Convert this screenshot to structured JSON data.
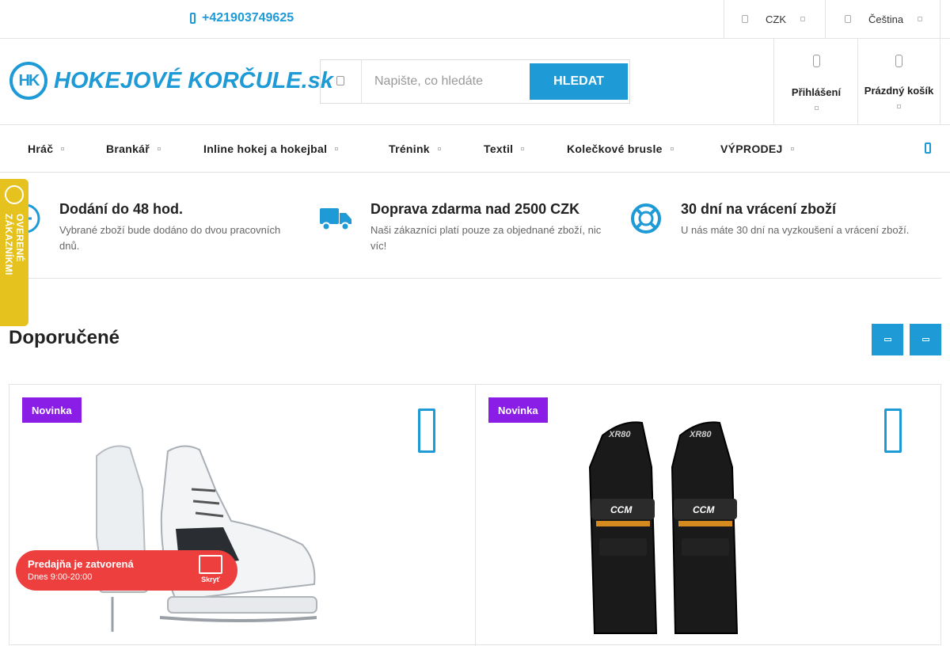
{
  "topbar": {
    "phone": "+421903749625",
    "currency": "CZK",
    "language": "Čeština"
  },
  "header": {
    "logo_text": "HOKEJOVÉ KORČULE.sk",
    "logo_mark": "HK",
    "search": {
      "placeholder": "Napište, co hledáte",
      "button_label": "HLEDAT"
    },
    "login_label": "Přihlášení",
    "cart_label": "Prázdný košík"
  },
  "nav": {
    "items": [
      {
        "label": "Hráč"
      },
      {
        "label": "Brankář"
      },
      {
        "label": "Inline hokej a hokejbal"
      },
      {
        "label": "Trénink"
      },
      {
        "label": "Textil"
      },
      {
        "label": "Kolečkové brusle"
      },
      {
        "label": "VÝPRODEJ"
      }
    ]
  },
  "benefits": [
    {
      "title": "Dodání do 48 hod.",
      "text": "Vybrané zboží bude dodáno do dvou pracovních dnů.",
      "icon": "clock-icon"
    },
    {
      "title": "Doprava zdarma nad 2500 CZK",
      "text": "Naši zákazníci platí pouze za objednané zboží, nic víc!",
      "icon": "truck-icon"
    },
    {
      "title": "30 dní na vrácení zboží",
      "text": "U nás máte 30 dní na vyzkoušení a vrácení zboží.",
      "icon": "lifebuoy-icon"
    }
  ],
  "section": {
    "title": "Doporučené"
  },
  "products": [
    {
      "badge": "Novinka",
      "image": "ice-skate"
    },
    {
      "badge": "Novinka",
      "image": "shin-guards",
      "brand_mark": "CCM",
      "model_mark": "XR80"
    }
  ],
  "side_badge": {
    "text": "OVERENÉ ZÁKAZNÍKMI"
  },
  "store_notice": {
    "title": "Predajňa je zatvorená",
    "hours": "Dnes 9:00-20:00",
    "hide_label": "Skryť"
  },
  "colors": {
    "accent": "#1e9ad6",
    "badge": "#8a1ee6",
    "store_notice": "#ee3f3f",
    "side_badge": "#e6c21f"
  }
}
